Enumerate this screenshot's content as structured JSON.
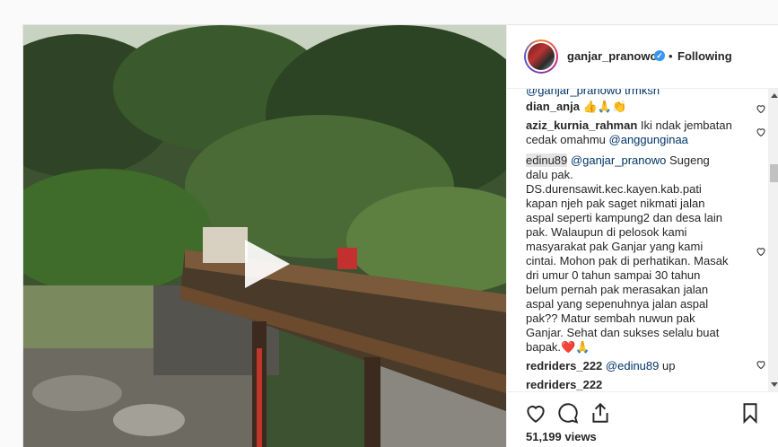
{
  "post": {
    "username": "ganjar_pranowo",
    "separator": "•",
    "follow_status": "Following",
    "views": "51,199 views"
  },
  "comments": [
    {
      "partial": "@ganjar_pranowo trmksh"
    },
    {
      "user": "dian_anja",
      "text": "👍🙏👏"
    },
    {
      "user": "aziz_kurnia_rahman",
      "text": "Iki ndak jembatan cedak omahmu",
      "mention": "@anggunginaa"
    },
    {
      "user": "edinu89",
      "mention": "@ganjar_pranowo",
      "text": "Sugeng dalu pak. DS.durensawit.kec.kayen.kab.pati kapan njeh pak saget nikmati jalan aspal seperti kampung2 dan desa lain pak. Walaupun di pelosok kami masyarakat pak Ganjar yang kami cintai. Mohon pak di perhatikan. Masak dri umur 0 tahun sampai 30 tahun belum pernah pak merasakan jalan aspal yang sepenuhnya jalan aspal pak?? Matur sembah nuwun pak Ganjar. Sehat dan sukses selalu buat bapak.❤️🙏"
    },
    {
      "user": "redriders_222",
      "mention": "@edinu89",
      "text": "up"
    },
    {
      "user": "redriders_222",
      "text": ""
    }
  ],
  "icons": {
    "verified": "verified-badge-icon",
    "play": "play-icon",
    "like": "heart-icon",
    "comment": "comment-icon",
    "share": "share-icon",
    "save": "bookmark-icon"
  }
}
